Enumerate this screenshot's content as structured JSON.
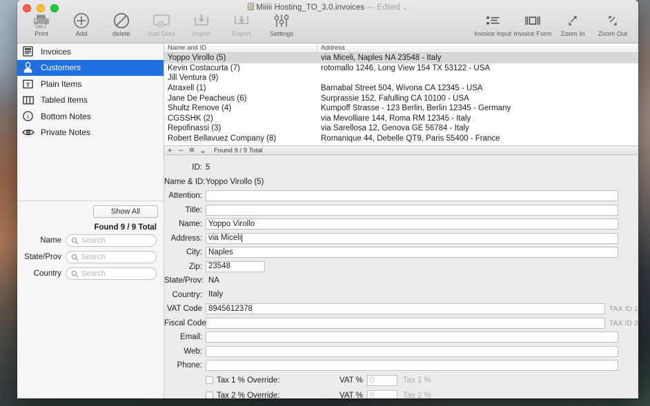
{
  "window": {
    "title": "Miiiii Hosting_TO_3.0.invoices",
    "edited_suffix": "— Edited",
    "chevron": "⌄"
  },
  "toolbar": {
    "left_items": [
      {
        "label": "Print",
        "icon": "printer-icon",
        "enabled": true
      },
      {
        "label": "Add",
        "icon": "plus-circle-icon",
        "enabled": true
      },
      {
        "label": "delete",
        "icon": "no-entry-icon",
        "enabled": true
      },
      {
        "label": "Add Data",
        "icon": "add-data-icon",
        "enabled": false
      },
      {
        "label": "Import",
        "icon": "import-icon",
        "enabled": false
      },
      {
        "label": "Export",
        "icon": "export-icon",
        "enabled": false
      },
      {
        "label": "Settings",
        "icon": "sliders-icon",
        "enabled": true
      }
    ],
    "right_items": [
      {
        "label": "Invoice Input",
        "icon": "list-icon"
      },
      {
        "label": "Invoice Form",
        "icon": "form-icon"
      },
      {
        "label": "Zoom In",
        "icon": "zoom-in-icon"
      },
      {
        "label": "Zoom Out",
        "icon": "zoom-out-icon"
      }
    ]
  },
  "sidebar": {
    "items": [
      {
        "label": "Invoices",
        "icon": "invoice-icon",
        "selected": false
      },
      {
        "label": "Customers",
        "icon": "person-icon",
        "selected": true
      },
      {
        "label": "Plain Items",
        "icon": "text-box-icon",
        "selected": false
      },
      {
        "label": "Tabled Items",
        "icon": "columns-icon",
        "selected": false
      },
      {
        "label": "Bottom Notes",
        "icon": "info-icon",
        "selected": false
      },
      {
        "label": "Private Notes",
        "icon": "eye-icon",
        "selected": false
      }
    ],
    "show_all_label": "Show All",
    "found_label": "Found 9 / 9 Total",
    "search_rows": [
      {
        "label": "Name",
        "value": "",
        "placeholder": "Search"
      },
      {
        "label": "State/Prov",
        "value": "",
        "placeholder": "Search"
      },
      {
        "label": "Country",
        "value": "",
        "placeholder": "Search"
      }
    ]
  },
  "list": {
    "columns": [
      "Name and ID",
      "Address"
    ],
    "rows": [
      {
        "name": "Yoppo Virollo (5)",
        "address": "via Miceli, Naples  NA  23548  - Italy",
        "selected": true
      },
      {
        "name": "Kevin Costacurta (7)",
        "address": "rotomallo 1246, Long View  154  TX  53122  - USA",
        "selected": false
      },
      {
        "name": "Jill Ventura (9)",
        "address": "",
        "selected": false
      },
      {
        "name": "Atraxell (1)",
        "address": "Barnabal Street 504, Wivona  CA  12345  - USA",
        "selected": false
      },
      {
        "name": "Jane De Peacheus (6)",
        "address": "Surprassie 152, Fafulling  CA  10100  - USA",
        "selected": false
      },
      {
        "name": "Shultz Renove (4)",
        "address": "Kumpoff Strasse - 123 Berlin, Berlin  12345  - Germany",
        "selected": false
      },
      {
        "name": "CGSSHK (2)",
        "address": "via Mevolliare 144, Roma  RM  12345  - Italy",
        "selected": false
      },
      {
        "name": "Repofinassi (3)",
        "address": "via Sarellosa 12, Genova  GE  56784  - Italy",
        "selected": false
      },
      {
        "name": "Robert Bellavuez Company (8)",
        "address": "Romanique 44, Debelle QT9, Paris  55400  - France",
        "selected": false
      }
    ],
    "statusbar": {
      "add": "+",
      "remove": "−",
      "gear": "✲",
      "chevron": "⌄",
      "found": "Found 9 / 9 Total"
    }
  },
  "form": {
    "id_label": "ID:",
    "id_value": "5",
    "name_id_label": "Name & ID:",
    "name_id_value": "Yoppo Virollo (5)",
    "fields": [
      {
        "label": "Attention:",
        "value": "",
        "style": "boxed"
      },
      {
        "label": "Title:",
        "value": "",
        "style": "boxed"
      },
      {
        "label": "Name:",
        "value": "Yoppo Virollo",
        "style": "boxed"
      },
      {
        "label": "Address:",
        "value": "via Miceli",
        "style": "boxed",
        "caret": true
      },
      {
        "label": "City:",
        "value": "Naples",
        "style": "boxed"
      }
    ],
    "zip": {
      "label": "Zip:",
      "value": "23548"
    },
    "flat_fields": [
      {
        "label": "State/Prov:",
        "value": "NA"
      },
      {
        "label": "Country:",
        "value": "Italy"
      }
    ],
    "tax_fields": [
      {
        "label": "VAT Code",
        "value": "8945612378",
        "badge": "TAX ID 1"
      },
      {
        "label": "Fiscal Code",
        "value": "",
        "badge": "TAX ID 2"
      }
    ],
    "contact_fields": [
      {
        "label": "Email:",
        "value": ""
      },
      {
        "label": "Web:",
        "value": ""
      },
      {
        "label": "Phone:",
        "value": ""
      }
    ],
    "overrides": [
      {
        "checkbox_label": "Tax 1 % Override:",
        "checked": false,
        "vat_label": "VAT %",
        "vat_value": "0",
        "note": "Tax 1 %"
      },
      {
        "checkbox_label": "Tax 2 % Override:",
        "checked": false,
        "vat_label": "VAT %",
        "vat_value": "0",
        "note": "Tax 2 %"
      }
    ]
  },
  "colors": {
    "selection_blue": "#1f6fe0",
    "row_selected_gray": "#d8d8d8",
    "window_chrome": "#ececec"
  }
}
